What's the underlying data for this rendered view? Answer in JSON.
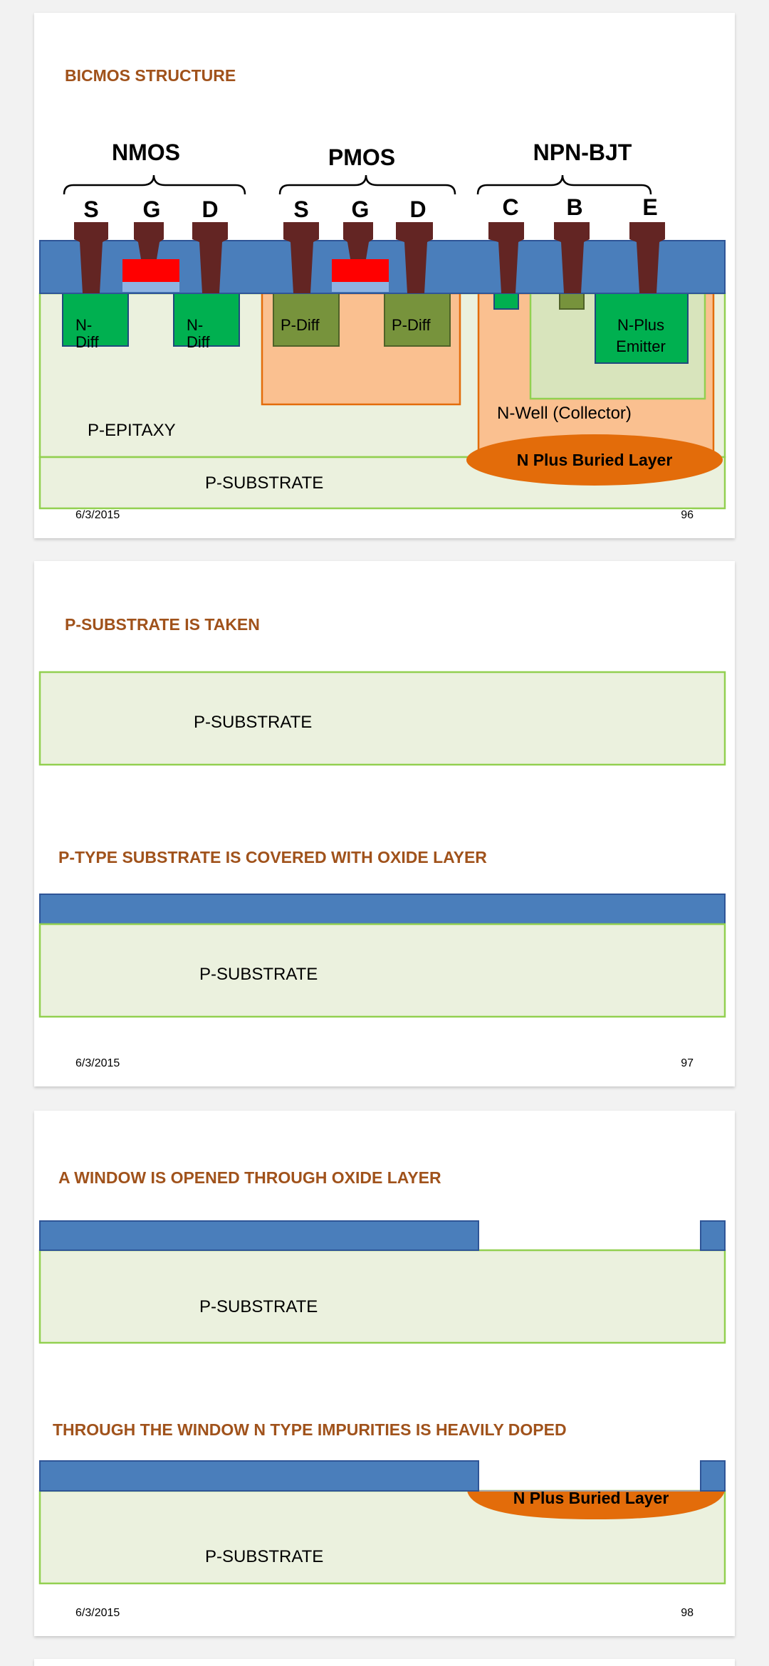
{
  "slides": [
    {
      "title": "BICMOS STRUCTURE",
      "groups": {
        "nmos": "NMOS",
        "pmos": "PMOS",
        "npn": "NPN-BJT"
      },
      "terminals": {
        "nmos": [
          "S",
          "G",
          "D"
        ],
        "pmos": [
          "S",
          "G",
          "D"
        ],
        "npn": [
          "C",
          "B",
          "E"
        ]
      },
      "regions": {
        "n_diff_1": [
          "N-",
          "Diff"
        ],
        "n_diff_2": [
          "N-",
          "Diff"
        ],
        "p_diff_1": "P-Diff",
        "p_diff_2": "P-Diff",
        "n_plus_emitter": [
          "N-Plus",
          "Emitter"
        ],
        "n_well": "N-Well (Collector)",
        "p_epitaxy": "P-EPITAXY",
        "buried_layer": "N Plus Buried Layer",
        "substrate": "P-SUBSTRATE"
      },
      "date": "6/3/2015",
      "page_number": "96"
    },
    {
      "title_1": "P-SUBSTRATE IS TAKEN",
      "substrate_1": "P-SUBSTRATE",
      "title_2": "P-TYPE SUBSTRATE IS COVERED WITH OXIDE LAYER",
      "substrate_2": "P-SUBSTRATE",
      "date": "6/3/2015",
      "page_number": "97"
    },
    {
      "title_1": "A WINDOW IS OPENED THROUGH OXIDE LAYER",
      "substrate_1": "P-SUBSTRATE",
      "title_2": "THROUGH  THE WINDOW N TYPE IMPURITIES IS HEAVILY DOPED",
      "buried_layer": "N Plus Buried Layer",
      "substrate_2": "P-SUBSTRATE",
      "date": "6/3/2015",
      "page_number": "98"
    }
  ],
  "colors": {
    "title": "#a0521b",
    "oxide": "#4a7ebb",
    "substrate_fill": "#ebf1de",
    "substrate_border": "#92d050",
    "n_diff": "#00b050",
    "p_diff": "#77933c",
    "n_well": "#fac090",
    "buried_layer": "#e36c0a",
    "metal": "#632523",
    "poly": "#ff0000",
    "gate_oxide": "#8db3e2"
  }
}
